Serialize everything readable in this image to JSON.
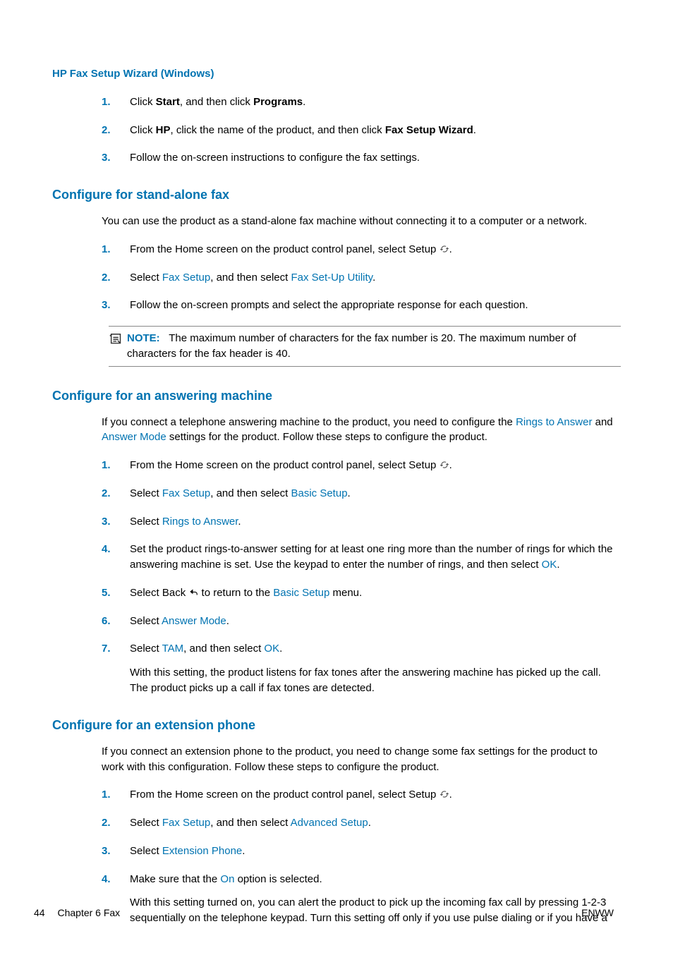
{
  "section0": {
    "heading": "HP Fax Setup Wizard (Windows)",
    "steps": [
      {
        "pre": "Click ",
        "b1": "Start",
        "mid": ", and then click ",
        "b2": "Programs",
        "post": "."
      },
      {
        "pre": "Click ",
        "b1": "HP",
        "mid": ", click the name of the product, and then click ",
        "b2": "Fax Setup Wizard",
        "post": "."
      },
      {
        "text": "Follow the on-screen instructions to configure the fax settings."
      }
    ]
  },
  "section1": {
    "heading": "Configure for stand-alone fax",
    "intro": "You can use the product as a stand-alone fax machine without connecting it to a computer or a network.",
    "steps": [
      {
        "setup_pre": "From the Home screen on the product control panel, select Setup ",
        "setup_post": "."
      },
      {
        "pre": "Select ",
        "m1": "Fax Setup",
        "mid": ", and then select ",
        "m2": "Fax Set-Up Utility",
        "post": "."
      },
      {
        "text": "Follow the on-screen prompts and select the appropriate response for each question."
      }
    ],
    "note_label": "NOTE:",
    "note_text": "The maximum number of characters for the fax number is 20. The maximum number of characters for the fax header is 40."
  },
  "section2": {
    "heading": "Configure for an answering machine",
    "intro_pre": "If you connect a telephone answering machine to the product, you need to configure the ",
    "intro_m1": "Rings to Answer",
    "intro_mid": " and ",
    "intro_m2": "Answer Mode",
    "intro_post": " settings for the product. Follow these steps to configure the product.",
    "steps": [
      {
        "setup_pre": "From the Home screen on the product control panel, select Setup ",
        "setup_post": "."
      },
      {
        "pre": "Select ",
        "m1": "Fax Setup",
        "mid": ", and then select ",
        "m2": "Basic Setup",
        "post": "."
      },
      {
        "pre": "Select ",
        "m1": "Rings to Answer",
        "post": "."
      },
      {
        "text_pre": "Set the product rings-to-answer setting for at least one ring more than the number of rings for which the answering machine is set. Use the keypad to enter the number of rings, and then select ",
        "m1": "OK",
        "post": "."
      },
      {
        "back_pre": "Select Back ",
        "back_mid": " to return to the ",
        "m1": "Basic Setup",
        "back_post": " menu."
      },
      {
        "pre": "Select ",
        "m1": "Answer Mode",
        "post": "."
      },
      {
        "pre": "Select ",
        "m1": "TAM",
        "mid": ", and then select ",
        "m2": "OK",
        "post": ".",
        "after": "With this setting, the product listens for fax tones after the answering machine has picked up the call. The product picks up a call if fax tones are detected."
      }
    ]
  },
  "section3": {
    "heading": "Configure for an extension phone",
    "intro": "If you connect an extension phone to the product, you need to change some fax settings for the product to work with this configuration. Follow these steps to configure the product.",
    "steps": [
      {
        "setup_pre": "From the Home screen on the product control panel, select Setup ",
        "setup_post": "."
      },
      {
        "pre": "Select ",
        "m1": "Fax Setup",
        "mid": ", and then select ",
        "m2": "Advanced Setup",
        "post": "."
      },
      {
        "pre": "Select ",
        "m1": "Extension Phone",
        "post": "."
      },
      {
        "text_pre": "Make sure that the ",
        "m1": "On",
        "text_post": " option is selected.",
        "after": "With this setting turned on, you can alert the product to pick up the incoming fax call by pressing 1-2-3 sequentially on the telephone keypad. Turn this setting off only if you use pulse dialing or if you have a"
      }
    ]
  },
  "footer": {
    "page": "44",
    "chapter": "Chapter 6   Fax",
    "right": "ENWW"
  }
}
